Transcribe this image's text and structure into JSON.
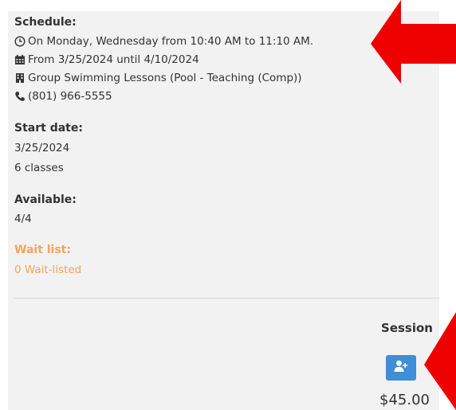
{
  "schedule": {
    "title": "Schedule:",
    "lines": [
      {
        "icon": "clock-icon",
        "text": "On Monday, Wednesday from 10:40 AM to 11:10 AM."
      },
      {
        "icon": "calendar-icon",
        "text": "From 3/25/2024 until 4/10/2024"
      },
      {
        "icon": "building-icon",
        "text": "Group Swimming Lessons (Pool - Teaching (Comp))"
      },
      {
        "icon": "phone-icon",
        "text": "(801) 966-5555"
      }
    ]
  },
  "start_date": {
    "title": "Start date:",
    "date": "3/25/2024",
    "classes": "6 classes"
  },
  "available": {
    "title": "Available:",
    "value": "4/4"
  },
  "wait_list": {
    "title": "Wait list:",
    "value": "0 Wait-listed"
  },
  "session": {
    "label": "Session",
    "enroll_icon": "user-plus-icon",
    "price": "$45.00"
  },
  "colors": {
    "panel_bg": "#f2f2f2",
    "wait_list": "#f6a35a",
    "button": "#3e8ed8",
    "arrow": "#ee0000"
  }
}
